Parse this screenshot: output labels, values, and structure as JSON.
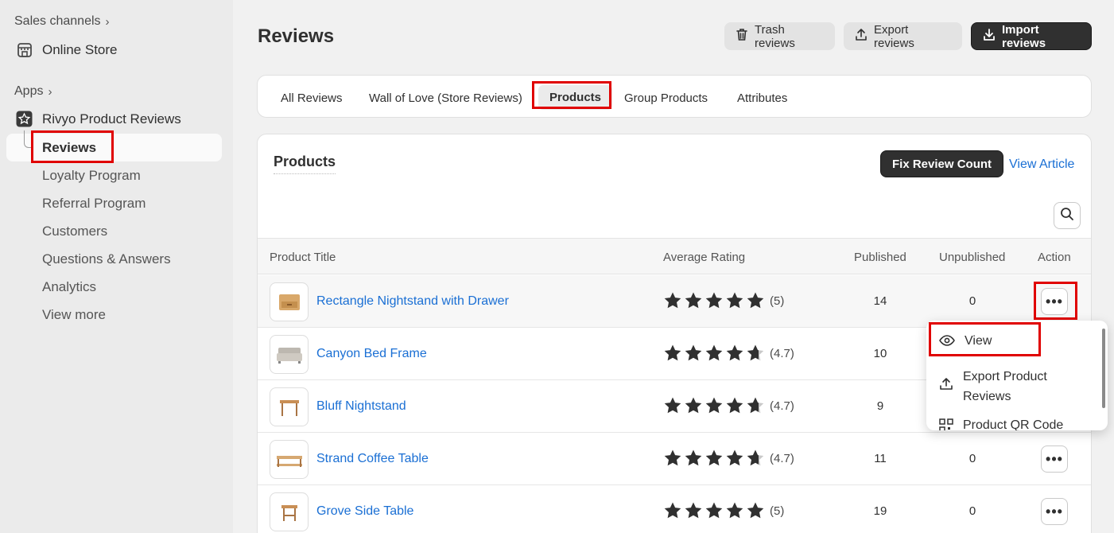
{
  "sidebar": {
    "sales_channels_label": "Sales channels",
    "online_store_label": "Online Store",
    "apps_label": "Apps",
    "app_name": "Rivyo Product Reviews",
    "sub_items": [
      "Reviews",
      "Loyalty Program",
      "Referral Program",
      "Customers",
      "Questions & Answers",
      "Analytics",
      "View more"
    ]
  },
  "header": {
    "title": "Reviews",
    "trash_label": "Trash reviews",
    "export_label": "Export reviews",
    "import_label": "Import reviews"
  },
  "tabs": [
    "All Reviews",
    "Wall of Love (Store Reviews)",
    "Products",
    "Group Products",
    "Attributes"
  ],
  "card": {
    "title": "Products",
    "fix_label": "Fix Review Count",
    "view_article_label": "View Article"
  },
  "table": {
    "columns": [
      "Product Title",
      "Average Rating",
      "Published",
      "Unpublished",
      "Action"
    ],
    "rows": [
      {
        "title": "Rectangle Nightstand with Drawer",
        "rating": "(5)",
        "stars": 5,
        "published": "14",
        "unpublished": "0"
      },
      {
        "title": "Canyon Bed Frame",
        "rating": "(4.7)",
        "stars": 4.7,
        "published": "10",
        "unpublished": ""
      },
      {
        "title": "Bluff Nightstand",
        "rating": "(4.7)",
        "stars": 4.7,
        "published": "9",
        "unpublished": ""
      },
      {
        "title": "Strand Coffee Table",
        "rating": "(4.7)",
        "stars": 4.7,
        "published": "11",
        "unpublished": "0"
      },
      {
        "title": "Grove Side Table",
        "rating": "(5)",
        "stars": 5,
        "published": "19",
        "unpublished": "0"
      }
    ]
  },
  "popover": {
    "view_label": "View",
    "export_label_line1": "Export Product",
    "export_label_line2": "Reviews",
    "qr_label": "Product QR Code"
  },
  "colors": {
    "link": "#1a6fd4",
    "highlight": "#e00000",
    "dark_button": "#303030"
  }
}
